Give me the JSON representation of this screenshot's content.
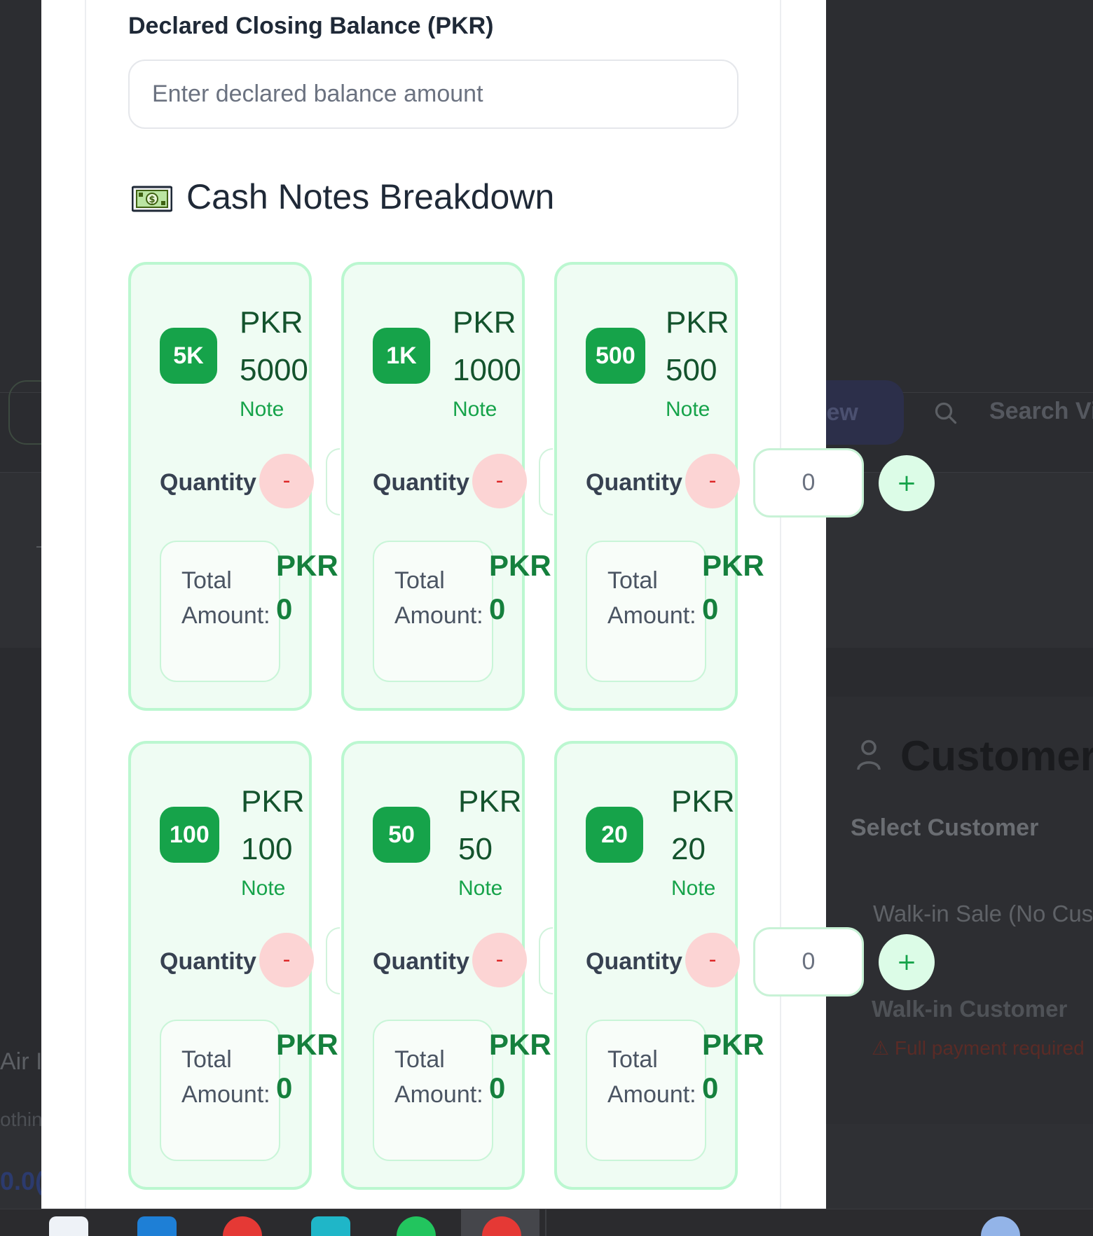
{
  "background": {
    "view_button_fragment": "iew",
    "search_placeholder": "Search Vi",
    "customer_section_title": "Customer S",
    "select_customer_label": "Select Customer",
    "walkin_sale_option": "Walk-in Sale (No Cus",
    "walkin_customer": "Walk-in Customer",
    "payment_warning": "⚠ Full payment required",
    "product_fragment": "Air I",
    "subtext_fragment": "othin",
    "amount_fragment": "0.0("
  },
  "form": {
    "balance_label": "Declared Closing Balance (PKR)",
    "balance_placeholder": "Enter declared balance amount",
    "balance_value": "",
    "section_title": "Cash Notes Breakdown",
    "section_icon": "dollar-banknote-icon"
  },
  "notes": [
    {
      "badge": "5K",
      "currency": "PKR",
      "value": "5000",
      "note_label": "Note",
      "quantity_label": "Quantity",
      "minus": "-",
      "total_label": "Total Amount:",
      "total_currency": "PKR",
      "total_value": "0"
    },
    {
      "badge": "1K",
      "currency": "PKR",
      "value": "1000",
      "note_label": "Note",
      "quantity_label": "Quantity",
      "minus": "-",
      "total_label": "Total Amount:",
      "total_currency": "PKR",
      "total_value": "0"
    },
    {
      "badge": "500",
      "currency": "PKR",
      "value": "500",
      "note_label": "Note",
      "quantity_label": "Quantity",
      "minus": "-",
      "total_label": "Total Amount:",
      "total_currency": "PKR",
      "total_value": "0",
      "quantity_value": "0",
      "plus": "+"
    },
    {
      "badge": "100",
      "currency": "PKR",
      "value": "100",
      "note_label": "Note",
      "quantity_label": "Quantity",
      "minus": "-",
      "total_label": "Total Amount:",
      "total_currency": "PKR",
      "total_value": "0"
    },
    {
      "badge": "50",
      "currency": "PKR",
      "value": "50",
      "note_label": "Note",
      "quantity_label": "Quantity",
      "minus": "-",
      "total_label": "Total Amount:",
      "total_currency": "PKR",
      "total_value": "0"
    },
    {
      "badge": "20",
      "currency": "PKR",
      "value": "20",
      "note_label": "Note",
      "quantity_label": "Quantity",
      "minus": "-",
      "total_label": "Total Amount:",
      "total_currency": "PKR",
      "total_value": "0",
      "quantity_value": "0",
      "plus": "+"
    }
  ],
  "colors": {
    "accent_green": "#16a34a",
    "card_background": "#effcf3",
    "card_border": "#bbf7d0",
    "minus_button": "#fcd4d4",
    "plus_button": "#dcfce7"
  }
}
